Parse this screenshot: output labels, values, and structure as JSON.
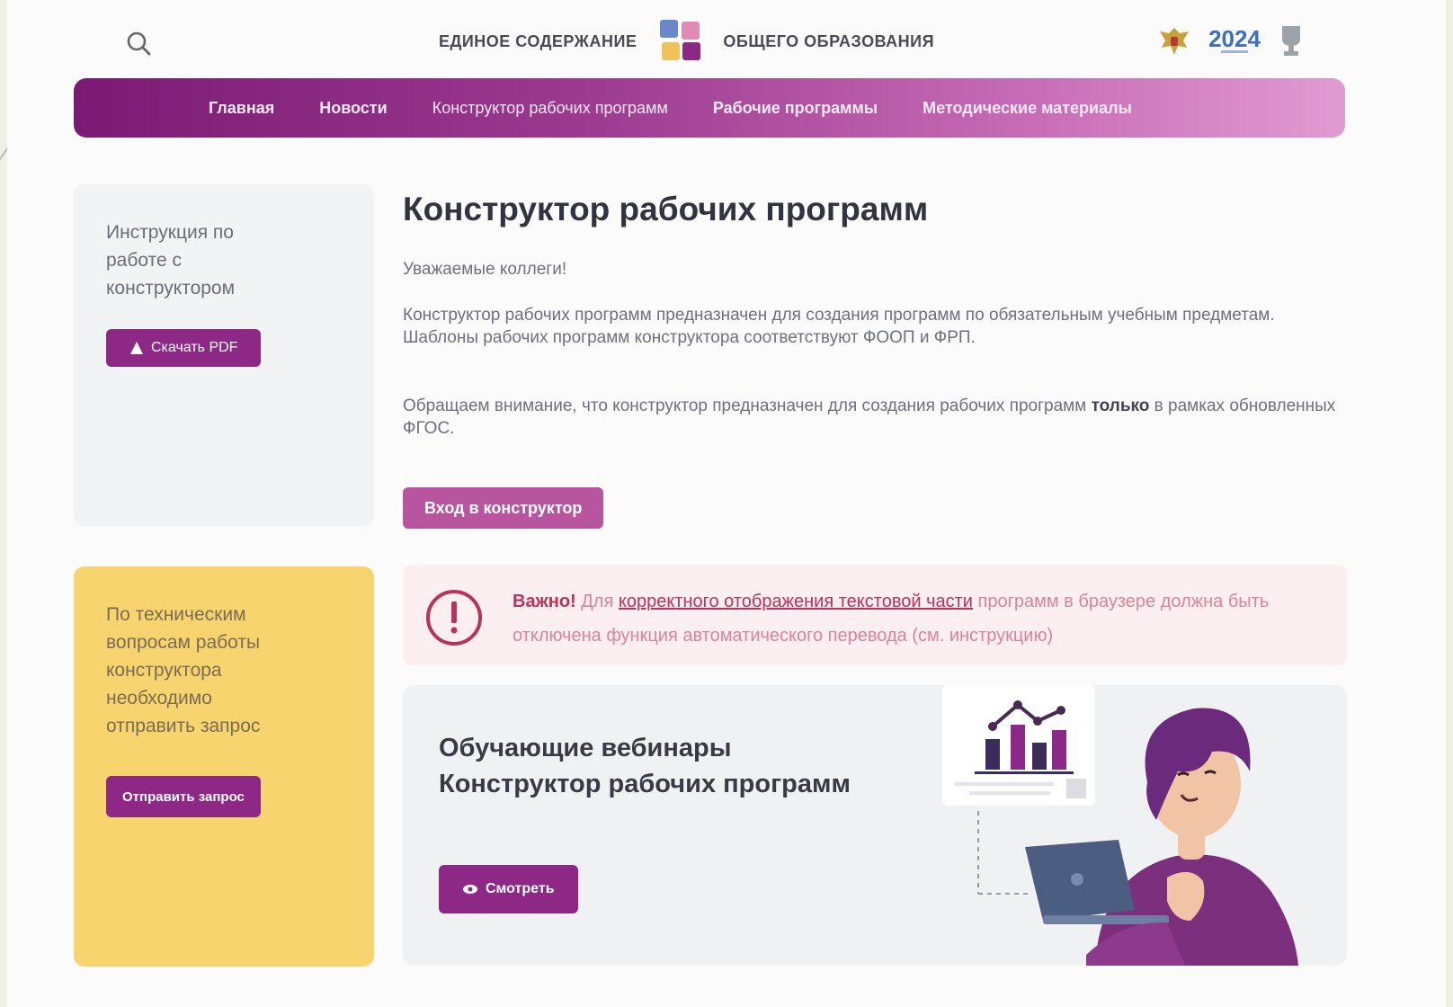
{
  "header": {
    "logo_left": "ЕДИНОЕ СОДЕРЖАНИЕ",
    "logo_right": "ОБЩЕГО ОБРАЗОВАНИЯ",
    "year_badge": "2024"
  },
  "nav": {
    "items": [
      "Главная",
      "Новости",
      "Конструктор рабочих программ",
      "Рабочие программы",
      "Методические материалы"
    ]
  },
  "side": {
    "instruction_text": "Инструкция по работе с конструктором",
    "download_label": "Скачать PDF",
    "support_text": "По техническим вопросам работы конструктора необходимо отправить запрос",
    "request_label": "Отправить запрос"
  },
  "main": {
    "title": "Конструктор рабочих программ",
    "greeting": "Уважаемые коллеги!",
    "para1": "Конструктор рабочих программ предназначен для создания программ по обязательным учебным предметам. Шаблоны рабочих программ конструктора соответствуют ФООП и ФРП.",
    "para2_prefix": "Обращаем внимание, что конструктор предназначен для создания рабочих программ ",
    "para2_bold": "только",
    "para2_suffix": " в рамках обновленных ФГОС.",
    "enter_label": "Вход в конструктор"
  },
  "alert": {
    "strong": "Важно!",
    "before_link": " Для ",
    "link": "корректного отображения текстовой части",
    "after_link": " программ в браузере должна быть отключена функция автоматического перевода (см. инструкцию)"
  },
  "webinar": {
    "title_line1": "Обучающие вебинары",
    "title_line2": "Конструктор рабочих программ",
    "watch_label": "Смотреть"
  },
  "colors": {
    "accent": "#8e2886",
    "alert": "#b8325a",
    "yellow": "#f7d46e"
  }
}
